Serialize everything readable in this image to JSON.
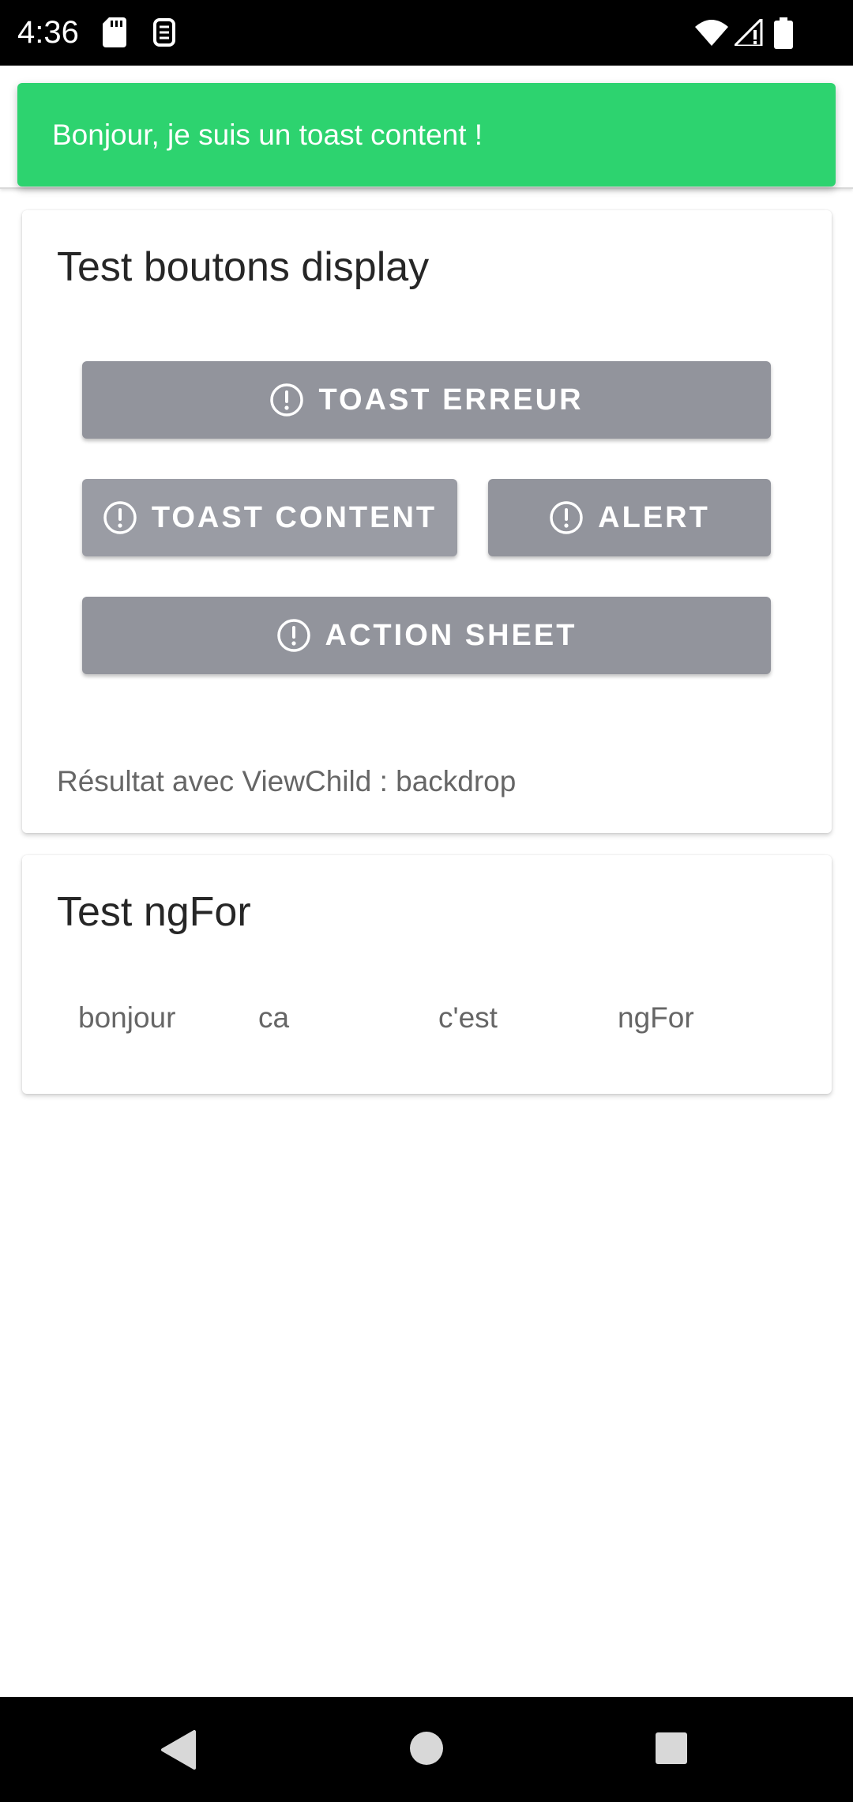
{
  "status_bar": {
    "time": "4:36",
    "icons": [
      "sd-card-icon",
      "sim-icon",
      "wifi-icon",
      "signal-icon",
      "battery-icon"
    ]
  },
  "toast": {
    "message": "Bonjour, je suis un toast content !",
    "color": "#2dd36f"
  },
  "card_buttons": {
    "title": "Test boutons display",
    "buttons": [
      {
        "label": "TOAST ERREUR",
        "icon": "alert-circle-icon"
      },
      {
        "label": "TOAST CONTENT",
        "icon": "alert-circle-icon"
      },
      {
        "label": "ALERT",
        "icon": "alert-circle-icon"
      },
      {
        "label": "ACTION SHEET",
        "icon": "alert-circle-icon"
      }
    ],
    "button_color": "#92949c",
    "result": "Résultat avec ViewChild : backdrop"
  },
  "card_ngfor": {
    "title": "Test ngFor",
    "items": [
      "bonjour",
      "ca",
      "c'est",
      "ngFor"
    ]
  },
  "nav_bar": {
    "buttons": [
      "back-icon",
      "home-icon",
      "recents-icon"
    ]
  }
}
